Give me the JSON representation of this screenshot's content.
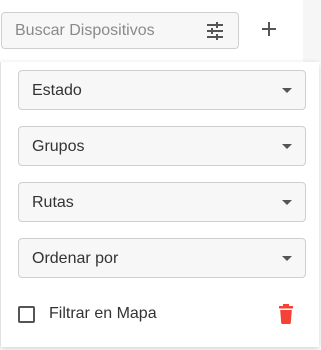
{
  "search": {
    "placeholder": "Buscar Dispositivos",
    "value": "",
    "filter_icon": "tune-icon"
  },
  "toolbar": {
    "add_icon": "plus-icon"
  },
  "filters": {
    "selects": [
      {
        "label": "Estado"
      },
      {
        "label": "Grupos"
      },
      {
        "label": "Rutas"
      },
      {
        "label": "Ordenar por"
      }
    ],
    "map_filter": {
      "label": "Filtrar en Mapa",
      "checked": false
    },
    "delete_icon": "trash-icon"
  },
  "colors": {
    "delete": "#f44336",
    "text": "#333333",
    "placeholder": "#8a8a8a"
  }
}
